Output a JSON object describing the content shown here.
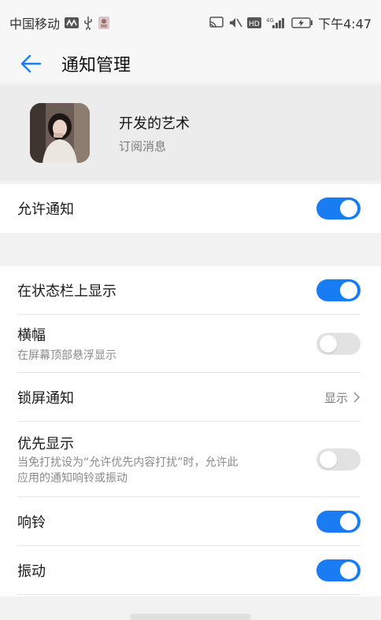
{
  "status_bar": {
    "carrier": "中国移动",
    "time": "下午4:47",
    "network": "4G"
  },
  "header": {
    "back_icon": "arrow-left-icon",
    "title": "通知管理",
    "accent": "#1a7cf3"
  },
  "app": {
    "name": "开发的艺术",
    "subtitle": "订阅消息"
  },
  "settings": {
    "allow_notifications": {
      "label": "允许通知",
      "enabled": true
    },
    "status_bar_display": {
      "label": "在状态栏上显示",
      "enabled": true
    },
    "banner": {
      "label": "横幅",
      "subtitle": "在屏幕顶部悬浮显示",
      "enabled": false
    },
    "lock_screen": {
      "label": "锁屏通知",
      "value": "显示"
    },
    "priority": {
      "label": "优先显示",
      "subtitle_line1": "当免打扰设为“允许优先内容打扰”时，允许此",
      "subtitle_line2": "应用的通知响铃或振动",
      "enabled": false
    },
    "ringtone": {
      "label": "响铃",
      "enabled": true
    },
    "vibrate": {
      "label": "振动",
      "enabled": true
    }
  }
}
